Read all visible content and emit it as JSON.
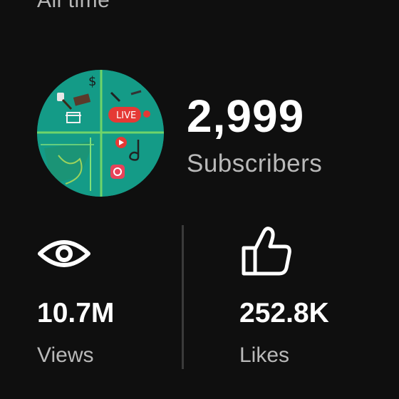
{
  "header": {
    "period_label": "All time"
  },
  "channel": {
    "subscribers_count": "2,999",
    "subscribers_label": "Subscribers",
    "avatar_badge": "LIVE"
  },
  "stats": {
    "views": {
      "value": "10.7M",
      "label": "Views",
      "icon": "eye-icon"
    },
    "likes": {
      "value": "252.8K",
      "label": "Likes",
      "icon": "thumbs-up-icon"
    }
  },
  "colors": {
    "background": "#0f0f0f",
    "primary_text": "#ffffff",
    "secondary_text": "#b9b9b9",
    "divider": "#3a3a3a",
    "avatar_green": "#139a86",
    "avatar_accent": "#e53935"
  }
}
